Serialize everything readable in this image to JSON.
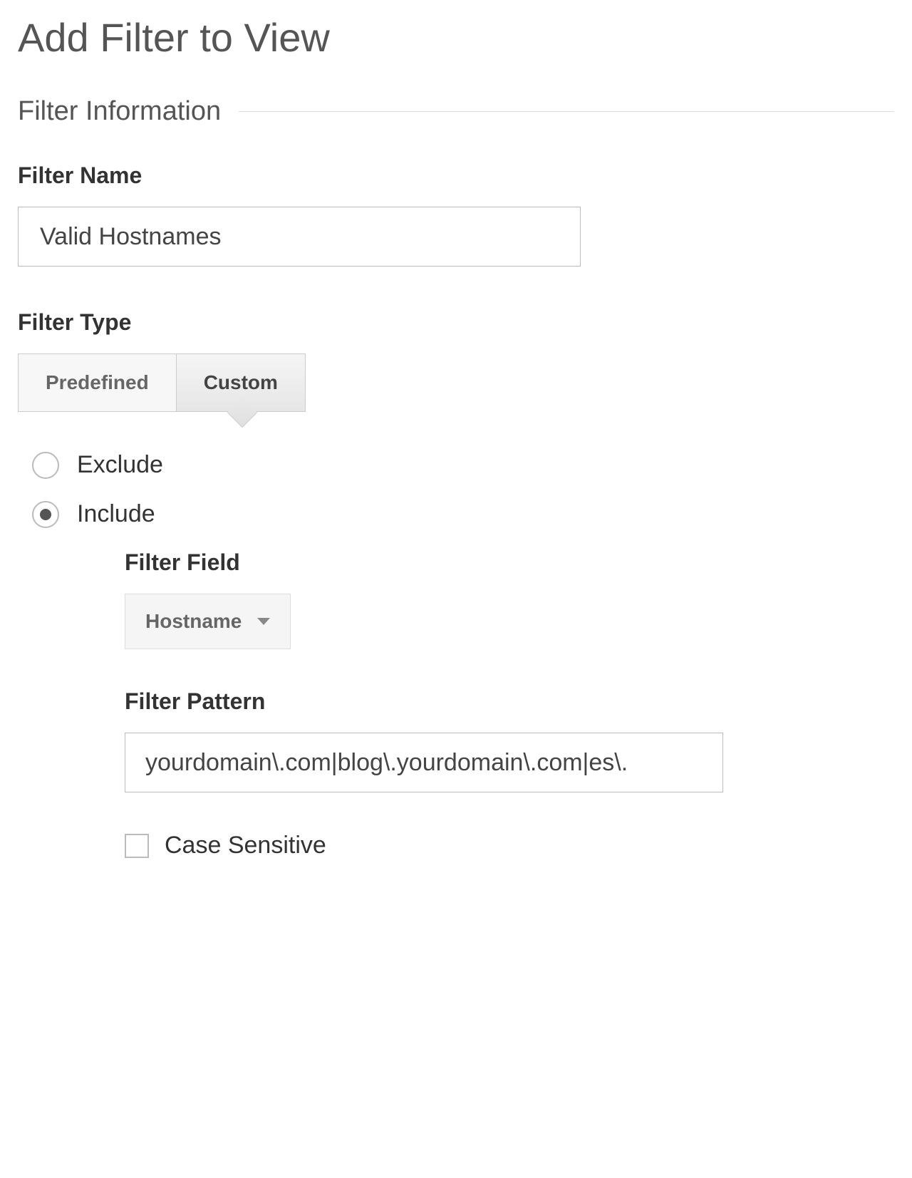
{
  "page_title": "Add Filter to View",
  "section_title": "Filter Information",
  "filter_name": {
    "label": "Filter Name",
    "value": "Valid Hostnames"
  },
  "filter_type": {
    "label": "Filter Type",
    "options": {
      "predefined": "Predefined",
      "custom": "Custom"
    },
    "selected": "custom"
  },
  "radio": {
    "exclude": "Exclude",
    "include": "Include",
    "selected": "include"
  },
  "filter_field": {
    "label": "Filter Field",
    "value": "Hostname"
  },
  "filter_pattern": {
    "label": "Filter Pattern",
    "value": "yourdomain\\.com|blog\\.yourdomain\\.com|es\\."
  },
  "case_sensitive": {
    "label": "Case Sensitive",
    "checked": false
  }
}
